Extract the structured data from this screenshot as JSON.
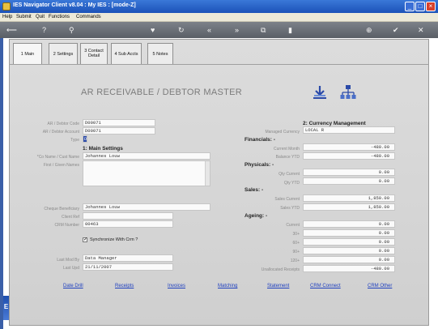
{
  "window": {
    "title": "IES Navigator Client v8.04 : My IES :      [mode-Z]"
  },
  "menu": [
    "Help",
    "Submit",
    "Quit",
    "Functions",
    "Commands"
  ],
  "toolbar_icons": [
    "back-arrow-icon",
    "help-icon",
    "search-icon",
    "heart-icon",
    "refresh-icon",
    "first-icon",
    "last-icon",
    "copy-icon",
    "delete-icon",
    "add-icon",
    "confirm-icon",
    "close-icon"
  ],
  "tabs": [
    {
      "label": "1 Main"
    },
    {
      "label": "2 Settings"
    },
    {
      "label": "3 Contact\nDetail"
    },
    {
      "label": "4 Sub Accts"
    },
    {
      "label": "5 Notes"
    }
  ],
  "header": "AR RECEIVABLE / DEBTOR MASTER",
  "left": {
    "code_label": "AR / Debtor Code",
    "code_value": "D00071",
    "account_label": "AR / Debtor Account",
    "account_value": "D00071",
    "type_label": "Type",
    "type_value": "D",
    "main_settings_title": "1: Main Settings",
    "coname_label": "*Co Name / Cust Name",
    "coname_value": "Johannes Louw",
    "first_label": "First / Given Names",
    "first_value": "",
    "cheque_label": "Cheque Beneficiary",
    "cheque_value": "Johannes Louw",
    "clientref_label": "Client Ref",
    "clientref_value": "",
    "crm_label": "CRM Number",
    "crm_value": "00463",
    "sync_label": "Synchronize With Crm ?",
    "sync_checked": "✓",
    "lastmod_label": "Last Mod By",
    "lastmod_value": "Data Manager",
    "lastupd_label": "Last Upd",
    "lastupd_value": "21/11/2007"
  },
  "right": {
    "currency_title": "2: Currency Management",
    "currency_label": "Managed Currency",
    "currency_value": "LOCAL R",
    "financials_title": "Financials: -",
    "curmonth_label": "Current Month",
    "curmonth_value": "-480.00",
    "balytd_label": "Balance YTD",
    "balytd_value": "-480.00",
    "physicals_title": "Physicals: -",
    "qtycur_label": "Qty Current",
    "qtycur_value": "0.00",
    "qtyytd_label": "Qty YTD",
    "qtyytd_value": "0.00",
    "sales_title": "Sales: -",
    "salescur_label": "Sales Current",
    "salescur_value": "1,850.00",
    "salesytd_label": "Sales YTD",
    "salesytd_value": "1,850.00",
    "ageing_title": "Ageing: -",
    "current_label": "Current",
    "current_value": "0.00",
    "d30_label": "30+",
    "d30_value": "0.00",
    "d60_label": "60+",
    "d60_value": "0.00",
    "d90_label": "90+",
    "d90_value": "0.00",
    "d120_label": "120+",
    "d120_value": "0.00",
    "unalloc_label": "Unallocated Receipts",
    "unalloc_value": "-480.00"
  },
  "links": [
    "Date Drill",
    "Receipts",
    "Invoices",
    "Matching",
    "Statement",
    "CRM Connect",
    "CRM Other"
  ],
  "side_logo": "E",
  "colors": {
    "accent": "#1e3fbf",
    "titlebar": "#2a62c8",
    "toolbar": "#6b7078"
  }
}
